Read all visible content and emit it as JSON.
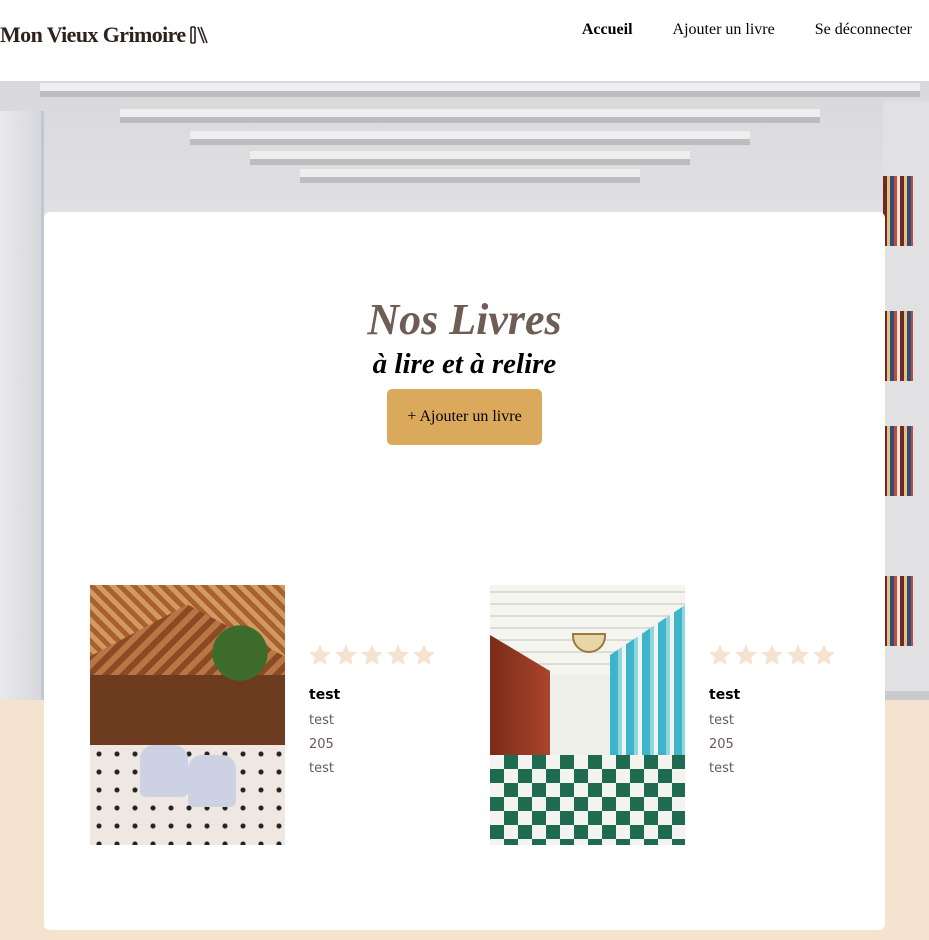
{
  "app": {
    "logo_text": "Mon Vieux Grimoire",
    "logo_icon": "books-icon"
  },
  "nav": {
    "items": [
      {
        "label": "Accueil",
        "active": true
      },
      {
        "label": "Ajouter un livre",
        "active": false
      },
      {
        "label": "Se déconnecter",
        "active": false
      }
    ]
  },
  "main": {
    "title": "Nos Livres",
    "subtitle": "à lire et à relire",
    "add_button_label": "+ Ajouter un livre"
  },
  "books": [
    {
      "title": "test",
      "author": "test",
      "year": "205",
      "genre": "test",
      "rating": 0,
      "max_rating": 5
    },
    {
      "title": "test",
      "author": "test",
      "year": "205",
      "genre": "test",
      "rating": 0,
      "max_rating": 5
    }
  ],
  "colors": {
    "accent_button": "#dba95c",
    "title_color": "#6f5c54",
    "page_background": "#f3e3cf",
    "star_empty": "#f3e3cf"
  }
}
